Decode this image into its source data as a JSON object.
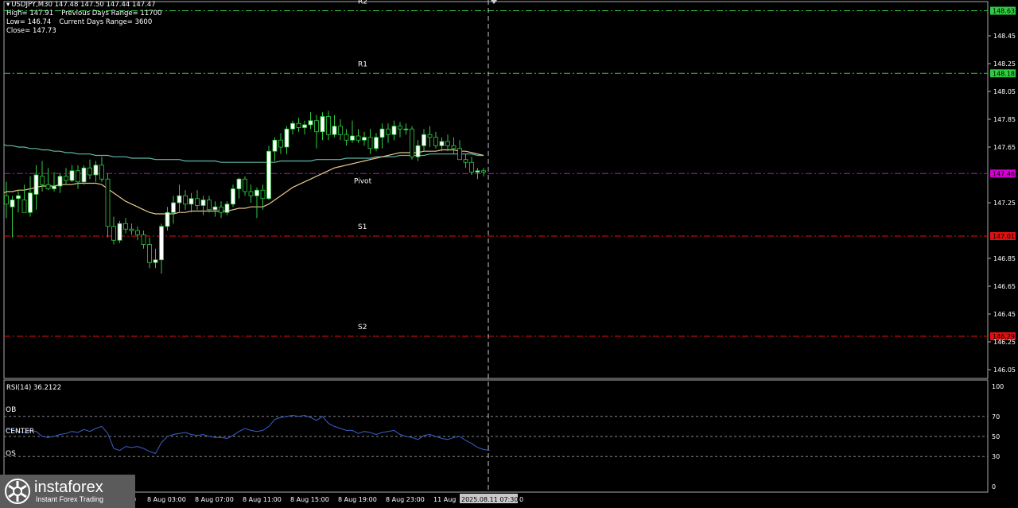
{
  "header": {
    "symbol_line": "USDJPY,M30  147.48 147.50 147.44 147.47",
    "high": "High= 147.91",
    "prev_range": "Previous Days Range= 11700",
    "low": "Low= 146.74",
    "curr_range": "Current Days Range= 3600",
    "close": "Close= 147.73"
  },
  "levels": {
    "r2": {
      "label": "R2",
      "value": 148.63,
      "tag": "148.63",
      "color": "#2ecc40"
    },
    "r1": {
      "label": "R1",
      "value": 148.18,
      "tag": "148.18",
      "color": "#2ecc40"
    },
    "pivot": {
      "label": "Pivot",
      "value": 147.46,
      "tag": "147.46",
      "color": "#d400d4"
    },
    "s1": {
      "label": "S1",
      "value": 147.01,
      "tag": "147.01",
      "color": "#e01010"
    },
    "s2": {
      "label": "S2",
      "value": 146.29,
      "tag": "146.29",
      "color": "#e01010"
    }
  },
  "rsi": {
    "label": "RSI(14) 36.2122",
    "ob_label": "OB",
    "center_label": "CENTER",
    "os_label": "OS"
  },
  "time_labels": [
    "8 Aug 03:00",
    "8 Aug 07:00",
    "8 Aug 11:00",
    "8 Aug 15:00",
    "8 Aug 19:00",
    "8 Aug 23:00",
    "11 Aug"
  ],
  "time_label_left_partial": "0",
  "crosshair_time": "2025.08.11 07:30",
  "crosshair_time_suffix": "0",
  "logo": {
    "brand": "instaforex",
    "tagline": "Instant Forex Trading"
  },
  "colors": {
    "bull": "#ffffff",
    "bear": "#2ecc40",
    "ma_slow": "#5fb8a8",
    "ma_fast": "#e8c989",
    "rsi_line": "#3a5fcc",
    "grid": "#888888",
    "axis_text": "#ffffff"
  },
  "chart_data": [
    {
      "type": "line",
      "title": "USDJPY,M30",
      "y_ticks": [
        148.45,
        148.25,
        148.05,
        147.85,
        147.65,
        147.25,
        146.85,
        146.65,
        146.45,
        146.25,
        146.05
      ],
      "ylim": [
        146.0,
        148.68
      ],
      "candles": [
        {
          "o": 147.3,
          "h": 147.4,
          "l": 147.14,
          "c": 147.24
        },
        {
          "o": 147.22,
          "h": 147.3,
          "l": 147.0,
          "c": 147.27
        },
        {
          "o": 147.28,
          "h": 147.34,
          "l": 147.18,
          "c": 147.3
        },
        {
          "o": 147.27,
          "h": 147.38,
          "l": 147.22,
          "c": 147.18
        },
        {
          "o": 147.18,
          "h": 147.44,
          "l": 147.15,
          "c": 147.32
        },
        {
          "o": 147.31,
          "h": 147.52,
          "l": 147.2,
          "c": 147.45
        },
        {
          "o": 147.44,
          "h": 147.55,
          "l": 147.33,
          "c": 147.38
        },
        {
          "o": 147.38,
          "h": 147.5,
          "l": 147.34,
          "c": 147.35
        },
        {
          "o": 147.35,
          "h": 147.47,
          "l": 147.33,
          "c": 147.37
        },
        {
          "o": 147.37,
          "h": 147.46,
          "l": 147.32,
          "c": 147.44
        },
        {
          "o": 147.44,
          "h": 147.5,
          "l": 147.38,
          "c": 147.41
        },
        {
          "o": 147.41,
          "h": 147.52,
          "l": 147.4,
          "c": 147.48
        },
        {
          "o": 147.48,
          "h": 147.52,
          "l": 147.35,
          "c": 147.4
        },
        {
          "o": 147.4,
          "h": 147.52,
          "l": 147.38,
          "c": 147.5
        },
        {
          "o": 147.5,
          "h": 147.56,
          "l": 147.42,
          "c": 147.45
        },
        {
          "o": 147.45,
          "h": 147.55,
          "l": 147.4,
          "c": 147.52
        },
        {
          "o": 147.52,
          "h": 147.58,
          "l": 147.4,
          "c": 147.42
        },
        {
          "o": 147.42,
          "h": 147.46,
          "l": 147.0,
          "c": 147.08
        },
        {
          "o": 147.08,
          "h": 147.15,
          "l": 146.95,
          "c": 146.98
        },
        {
          "o": 146.98,
          "h": 147.12,
          "l": 146.96,
          "c": 147.1
        },
        {
          "o": 147.1,
          "h": 147.14,
          "l": 147.03,
          "c": 147.06
        },
        {
          "o": 147.06,
          "h": 147.1,
          "l": 147.02,
          "c": 147.05
        },
        {
          "o": 147.05,
          "h": 147.08,
          "l": 146.98,
          "c": 147.02
        },
        {
          "o": 147.02,
          "h": 147.05,
          "l": 146.92,
          "c": 146.95
        },
        {
          "o": 146.95,
          "h": 147.0,
          "l": 146.78,
          "c": 146.82
        },
        {
          "o": 146.82,
          "h": 146.92,
          "l": 146.78,
          "c": 146.84
        },
        {
          "o": 146.84,
          "h": 147.1,
          "l": 146.74,
          "c": 147.08
        },
        {
          "o": 147.08,
          "h": 147.22,
          "l": 147.05,
          "c": 147.18
        },
        {
          "o": 147.18,
          "h": 147.3,
          "l": 147.1,
          "c": 147.25
        },
        {
          "o": 147.25,
          "h": 147.38,
          "l": 147.18,
          "c": 147.3
        },
        {
          "o": 147.3,
          "h": 147.34,
          "l": 147.2,
          "c": 147.24
        },
        {
          "o": 147.24,
          "h": 147.32,
          "l": 147.18,
          "c": 147.28
        },
        {
          "o": 147.28,
          "h": 147.34,
          "l": 147.2,
          "c": 147.23
        },
        {
          "o": 147.23,
          "h": 147.3,
          "l": 147.16,
          "c": 147.27
        },
        {
          "o": 147.27,
          "h": 147.3,
          "l": 147.18,
          "c": 147.2
        },
        {
          "o": 147.2,
          "h": 147.26,
          "l": 147.15,
          "c": 147.22
        },
        {
          "o": 147.22,
          "h": 147.26,
          "l": 147.14,
          "c": 147.18
        },
        {
          "o": 147.18,
          "h": 147.26,
          "l": 147.16,
          "c": 147.24
        },
        {
          "o": 147.24,
          "h": 147.38,
          "l": 147.22,
          "c": 147.35
        },
        {
          "o": 147.35,
          "h": 147.43,
          "l": 147.28,
          "c": 147.42
        },
        {
          "o": 147.42,
          "h": 147.44,
          "l": 147.3,
          "c": 147.33
        },
        {
          "o": 147.33,
          "h": 147.38,
          "l": 147.25,
          "c": 147.3
        },
        {
          "o": 147.3,
          "h": 147.36,
          "l": 147.14,
          "c": 147.34
        },
        {
          "o": 147.34,
          "h": 147.38,
          "l": 147.2,
          "c": 147.28
        },
        {
          "o": 147.28,
          "h": 147.66,
          "l": 147.27,
          "c": 147.62
        },
        {
          "o": 147.62,
          "h": 147.72,
          "l": 147.55,
          "c": 147.7
        },
        {
          "o": 147.7,
          "h": 147.75,
          "l": 147.6,
          "c": 147.65
        },
        {
          "o": 147.65,
          "h": 147.8,
          "l": 147.6,
          "c": 147.78
        },
        {
          "o": 147.78,
          "h": 147.84,
          "l": 147.74,
          "c": 147.82
        },
        {
          "o": 147.82,
          "h": 147.86,
          "l": 147.76,
          "c": 147.79
        },
        {
          "o": 147.79,
          "h": 147.84,
          "l": 147.74,
          "c": 147.81
        },
        {
          "o": 147.81,
          "h": 147.9,
          "l": 147.78,
          "c": 147.84
        },
        {
          "o": 147.84,
          "h": 147.88,
          "l": 147.64,
          "c": 147.76
        },
        {
          "o": 147.76,
          "h": 147.9,
          "l": 147.7,
          "c": 147.87
        },
        {
          "o": 147.87,
          "h": 147.91,
          "l": 147.7,
          "c": 147.74
        },
        {
          "o": 147.74,
          "h": 147.88,
          "l": 147.72,
          "c": 147.8
        },
        {
          "o": 147.8,
          "h": 147.85,
          "l": 147.7,
          "c": 147.74
        },
        {
          "o": 147.74,
          "h": 147.78,
          "l": 147.66,
          "c": 147.7
        },
        {
          "o": 147.7,
          "h": 147.84,
          "l": 147.68,
          "c": 147.73
        },
        {
          "o": 147.73,
          "h": 147.78,
          "l": 147.68,
          "c": 147.7
        },
        {
          "o": 147.7,
          "h": 147.76,
          "l": 147.66,
          "c": 147.72
        },
        {
          "o": 147.72,
          "h": 147.78,
          "l": 147.6,
          "c": 147.64
        },
        {
          "o": 147.64,
          "h": 147.75,
          "l": 147.62,
          "c": 147.72
        },
        {
          "o": 147.72,
          "h": 147.82,
          "l": 147.64,
          "c": 147.78
        },
        {
          "o": 147.78,
          "h": 147.82,
          "l": 147.68,
          "c": 147.74
        },
        {
          "o": 147.74,
          "h": 147.84,
          "l": 147.7,
          "c": 147.8
        },
        {
          "o": 147.8,
          "h": 147.83,
          "l": 147.72,
          "c": 147.78
        },
        {
          "o": 147.78,
          "h": 147.82,
          "l": 147.74,
          "c": 147.78
        },
        {
          "o": 147.78,
          "h": 147.8,
          "l": 147.56,
          "c": 147.58
        },
        {
          "o": 147.58,
          "h": 147.7,
          "l": 147.55,
          "c": 147.66
        },
        {
          "o": 147.66,
          "h": 147.78,
          "l": 147.62,
          "c": 147.74
        },
        {
          "o": 147.74,
          "h": 147.8,
          "l": 147.65,
          "c": 147.72
        },
        {
          "o": 147.72,
          "h": 147.76,
          "l": 147.64,
          "c": 147.66
        },
        {
          "o": 147.66,
          "h": 147.72,
          "l": 147.62,
          "c": 147.69
        },
        {
          "o": 147.69,
          "h": 147.74,
          "l": 147.62,
          "c": 147.66
        },
        {
          "o": 147.66,
          "h": 147.72,
          "l": 147.6,
          "c": 147.64
        },
        {
          "o": 147.64,
          "h": 147.7,
          "l": 147.58,
          "c": 147.56
        },
        {
          "o": 147.56,
          "h": 147.6,
          "l": 147.5,
          "c": 147.54
        },
        {
          "o": 147.54,
          "h": 147.58,
          "l": 147.45,
          "c": 147.47
        },
        {
          "o": 147.47,
          "h": 147.5,
          "l": 147.42,
          "c": 147.48
        },
        {
          "o": 147.48,
          "h": 147.5,
          "l": 147.44,
          "c": 147.47
        }
      ],
      "ma_slow": [
        147.66,
        147.66,
        147.65,
        147.65,
        147.64,
        147.64,
        147.63,
        147.63,
        147.62,
        147.62,
        147.61,
        147.61,
        147.6,
        147.6,
        147.6,
        147.59,
        147.59,
        147.59,
        147.58,
        147.58,
        147.58,
        147.57,
        147.57,
        147.57,
        147.57,
        147.56,
        147.56,
        147.56,
        147.56,
        147.56,
        147.55,
        147.55,
        147.55,
        147.55,
        147.55,
        147.55,
        147.54,
        147.54,
        147.54,
        147.54,
        147.54,
        147.54,
        147.54,
        147.54,
        147.54,
        147.54,
        147.55,
        147.55,
        147.55,
        147.55,
        147.55,
        147.55,
        147.56,
        147.56,
        147.56,
        147.56,
        147.56,
        147.57,
        147.57,
        147.57,
        147.57,
        147.57,
        147.58,
        147.58,
        147.58,
        147.58,
        147.59,
        147.59,
        147.59,
        147.59,
        147.59,
        147.6,
        147.6,
        147.6,
        147.6,
        147.6,
        147.6,
        147.6,
        147.6,
        147.59,
        147.59
      ],
      "ma_fast": [
        147.33,
        147.33,
        147.34,
        147.34,
        147.35,
        147.36,
        147.37,
        147.37,
        147.37,
        147.38,
        147.38,
        147.38,
        147.39,
        147.39,
        147.39,
        147.39,
        147.38,
        147.35,
        147.32,
        147.29,
        147.26,
        147.24,
        147.22,
        147.2,
        147.18,
        147.17,
        147.17,
        147.17,
        147.17,
        147.18,
        147.18,
        147.19,
        147.19,
        147.19,
        147.19,
        147.19,
        147.19,
        147.19,
        147.2,
        147.21,
        147.21,
        147.22,
        147.22,
        147.22,
        147.24,
        147.27,
        147.3,
        147.33,
        147.36,
        147.38,
        147.4,
        147.42,
        147.44,
        147.46,
        147.48,
        147.5,
        147.51,
        147.52,
        147.53,
        147.54,
        147.55,
        147.56,
        147.57,
        147.58,
        147.59,
        147.6,
        147.61,
        147.61,
        147.61,
        147.61,
        147.62,
        147.62,
        147.62,
        147.63,
        147.63,
        147.63,
        147.62,
        147.62,
        147.61,
        147.6,
        147.59
      ]
    },
    {
      "type": "line",
      "title": "RSI(14) 36.2122",
      "y_ticks": [
        100,
        70,
        50,
        30,
        0
      ],
      "ylim": [
        0,
        100
      ],
      "levels": {
        "ob": 70,
        "center": 50,
        "os": 30
      },
      "values": [
        58,
        56,
        55,
        54,
        56,
        55,
        50,
        49,
        50,
        52,
        53,
        55,
        54,
        57,
        55,
        58,
        60,
        53,
        38,
        36,
        40,
        39,
        40,
        38,
        35,
        33,
        44,
        50,
        52,
        53,
        54,
        52,
        51,
        52,
        50,
        49,
        49,
        48,
        51,
        55,
        58,
        56,
        55,
        56,
        60,
        67,
        69,
        70,
        71,
        70,
        71,
        69,
        66,
        70,
        63,
        60,
        58,
        56,
        56,
        53,
        55,
        54,
        52,
        54,
        55,
        56,
        52,
        50,
        49,
        47,
        51,
        52,
        50,
        48,
        47,
        49,
        50,
        46,
        43,
        39,
        37,
        36
      ]
    }
  ]
}
